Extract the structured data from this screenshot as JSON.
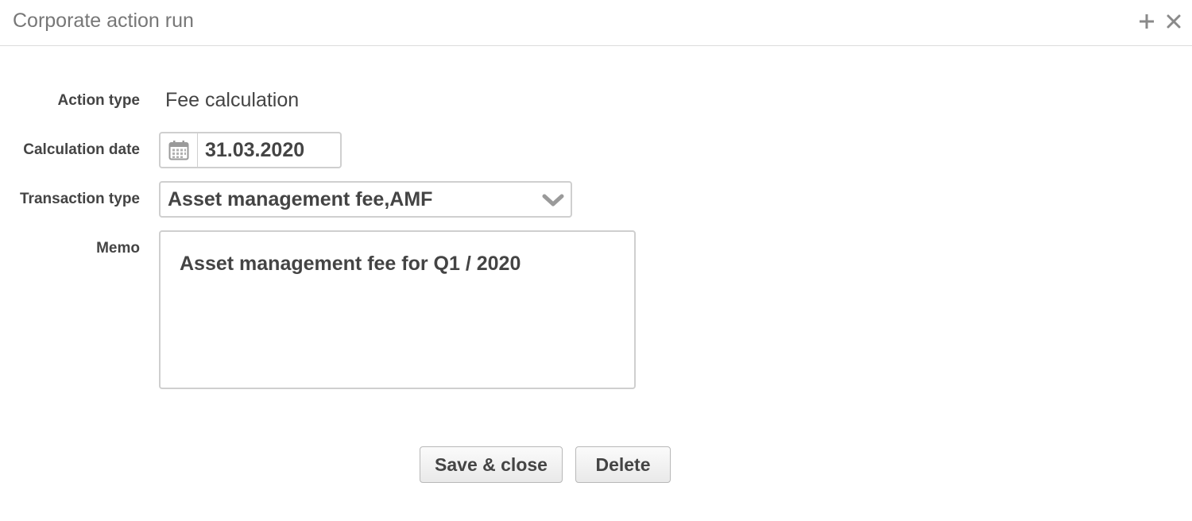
{
  "dialog": {
    "title": "Corporate action run",
    "add_icon": "plus-icon",
    "close_icon": "close-icon"
  },
  "form": {
    "action_type": {
      "label": "Action type",
      "value": "Fee calculation"
    },
    "calculation_date": {
      "label": "Calculation date",
      "value": "31.03.2020",
      "icon": "calendar-icon"
    },
    "transaction_type": {
      "label": "Transaction type",
      "value": "Asset management fee,AMF",
      "icon": "chevron-down-icon"
    },
    "memo": {
      "label": "Memo",
      "value": "Asset management fee for Q1 / 2020"
    }
  },
  "actions": {
    "save_label": "Save & close",
    "delete_label": "Delete"
  },
  "colors": {
    "border": "#cfcfcf",
    "text": "#444444",
    "title": "#777777",
    "icon": "#8a8a8a"
  }
}
